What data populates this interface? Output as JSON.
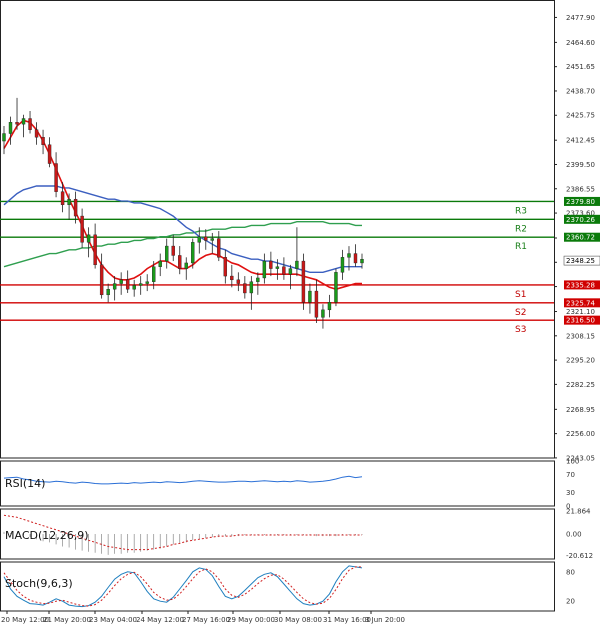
{
  "chart_data": {
    "type": "candlestick",
    "symbol_price_ylim": [
      2243.0,
      2484.0
    ],
    "price_ticks": [
      "2477.90",
      "2464.60",
      "2451.65",
      "2438.70",
      "2425.75",
      "2412.45",
      "2399.50",
      "2386.55",
      "2373.60",
      "2360.30",
      "2347.35",
      "2334.40",
      "2321.10",
      "2308.15",
      "2295.20",
      "2282.25",
      "2268.95",
      "2256.00",
      "2243.05"
    ],
    "x_ticks": [
      "20 May 12:00",
      "21 May 20:00",
      "23 May 04:00",
      "24 May 12:00",
      "27 May 16:00",
      "29 May 00:00",
      "30 May 08:00",
      "31 May 16:00",
      "3 Jun 20:00"
    ],
    "resistance": [
      {
        "label": "R1",
        "value": 2360.72,
        "tag": "2360.72"
      },
      {
        "label": "R2",
        "value": 2370.26,
        "tag": "2370.26"
      },
      {
        "label": "R3",
        "value": 2379.8,
        "tag": "2379.80"
      }
    ],
    "support": [
      {
        "label": "S1",
        "value": 2335.28,
        "tag": "2335.28"
      },
      {
        "label": "S2",
        "value": 2325.74,
        "tag": "2325.74"
      },
      {
        "label": "S3",
        "value": 2316.5,
        "tag": "2316.50"
      }
    ],
    "current_price": {
      "value": 2348.25,
      "tag": "2348.25"
    },
    "candles": [
      [
        2412,
        2420,
        2405,
        2416
      ],
      [
        2416,
        2425,
        2410,
        2422
      ],
      [
        2422,
        2435,
        2418,
        2421
      ],
      [
        2421,
        2426,
        2414,
        2424
      ],
      [
        2424,
        2428,
        2416,
        2418
      ],
      [
        2418,
        2422,
        2410,
        2414
      ],
      [
        2414,
        2418,
        2405,
        2410
      ],
      [
        2410,
        2414,
        2398,
        2400
      ],
      [
        2400,
        2406,
        2382,
        2385
      ],
      [
        2385,
        2390,
        2374,
        2378
      ],
      [
        2378,
        2384,
        2370,
        2381
      ],
      [
        2381,
        2385,
        2368,
        2372
      ],
      [
        2372,
        2376,
        2355,
        2358
      ],
      [
        2358,
        2366,
        2350,
        2362
      ],
      [
        2362,
        2368,
        2344,
        2346
      ],
      [
        2346,
        2352,
        2328,
        2330
      ],
      [
        2330,
        2336,
        2326,
        2333
      ],
      [
        2333,
        2340,
        2327,
        2336
      ],
      [
        2336,
        2342,
        2330,
        2338
      ],
      [
        2338,
        2343,
        2331,
        2333
      ],
      [
        2333,
        2338,
        2329,
        2335
      ],
      [
        2335,
        2340,
        2330,
        2336
      ],
      [
        2336,
        2341,
        2332,
        2337
      ],
      [
        2337,
        2348,
        2333,
        2345
      ],
      [
        2345,
        2352,
        2340,
        2348
      ],
      [
        2348,
        2360,
        2344,
        2356
      ],
      [
        2356,
        2362,
        2348,
        2351
      ],
      [
        2351,
        2356,
        2341,
        2344
      ],
      [
        2344,
        2350,
        2338,
        2347
      ],
      [
        2347,
        2360,
        2344,
        2358
      ],
      [
        2358,
        2366,
        2352,
        2361
      ],
      [
        2361,
        2365,
        2354,
        2359
      ],
      [
        2359,
        2363,
        2352,
        2360
      ],
      [
        2360,
        2364,
        2348,
        2350
      ],
      [
        2350,
        2354,
        2336,
        2340
      ],
      [
        2340,
        2346,
        2334,
        2338
      ],
      [
        2338,
        2342,
        2332,
        2336
      ],
      [
        2336,
        2340,
        2328,
        2331
      ],
      [
        2331,
        2340,
        2322,
        2337
      ],
      [
        2337,
        2342,
        2330,
        2339
      ],
      [
        2339,
        2352,
        2336,
        2348
      ],
      [
        2348,
        2353,
        2340,
        2344
      ],
      [
        2344,
        2349,
        2338,
        2345
      ],
      [
        2345,
        2350,
        2338,
        2341
      ],
      [
        2341,
        2346,
        2333,
        2344
      ],
      [
        2344,
        2366,
        2340,
        2348
      ],
      [
        2348,
        2352,
        2322,
        2326
      ],
      [
        2326,
        2336,
        2320,
        2332
      ],
      [
        2332,
        2338,
        2315,
        2318
      ],
      [
        2318,
        2325,
        2312,
        2322
      ],
      [
        2322,
        2330,
        2318,
        2326
      ],
      [
        2326,
        2344,
        2324,
        2342
      ],
      [
        2342,
        2354,
        2338,
        2350
      ],
      [
        2350,
        2356,
        2343,
        2352
      ],
      [
        2352,
        2357,
        2345,
        2347
      ],
      [
        2347,
        2352,
        2344,
        2349
      ]
    ],
    "ma_red": [
      2408,
      2414,
      2420,
      2423,
      2422,
      2418,
      2412,
      2405,
      2397,
      2389,
      2381,
      2374,
      2367,
      2359,
      2352,
      2346,
      2342,
      2339,
      2338,
      2338,
      2339,
      2341,
      2344,
      2346,
      2348,
      2348,
      2346,
      2344,
      2344,
      2346,
      2349,
      2351,
      2352,
      2351,
      2349,
      2347,
      2346,
      2344,
      2342,
      2341,
      2341,
      2341,
      2341,
      2341,
      2341,
      2341,
      2340,
      2339,
      2338,
      2336,
      2334,
      2333,
      2334,
      2335,
      2336,
      2336
    ],
    "ma_blue": [
      2378,
      2381,
      2384,
      2386,
      2387,
      2388,
      2388,
      2388,
      2388,
      2387,
      2387,
      2386,
      2385,
      2384,
      2383,
      2382,
      2381,
      2381,
      2380,
      2380,
      2379,
      2379,
      2378,
      2377,
      2376,
      2374,
      2372,
      2369,
      2366,
      2364,
      2361,
      2359,
      2357,
      2355,
      2354,
      2352,
      2351,
      2350,
      2349,
      2349,
      2348,
      2348,
      2347,
      2346,
      2345,
      2344,
      2343,
      2342,
      2342,
      2342,
      2343,
      2344,
      2345,
      2345,
      2345,
      2345
    ],
    "ma_green": [
      2345,
      2346,
      2347,
      2348,
      2349,
      2350,
      2351,
      2352,
      2352,
      2353,
      2354,
      2354,
      2355,
      2355,
      2356,
      2356,
      2357,
      2357,
      2358,
      2358,
      2359,
      2359,
      2360,
      2360,
      2361,
      2361,
      2362,
      2362,
      2363,
      2363,
      2364,
      2364,
      2365,
      2365,
      2365,
      2366,
      2366,
      2366,
      2367,
      2367,
      2367,
      2368,
      2368,
      2368,
      2368,
      2369,
      2369,
      2369,
      2369,
      2369,
      2368,
      2368,
      2368,
      2368,
      2367,
      2367
    ],
    "rsi": {
      "label": "RSI(14)",
      "ticks": [
        "100",
        "70",
        "30",
        "0"
      ],
      "values": [
        62,
        63,
        64,
        60,
        58,
        55,
        54,
        53,
        55,
        54,
        52,
        51,
        53,
        52,
        50,
        49,
        49,
        50,
        51,
        50,
        52,
        51,
        52,
        53,
        52,
        54,
        53,
        52,
        53,
        55,
        56,
        55,
        54,
        53,
        53,
        54,
        55,
        55,
        54,
        55,
        56,
        55,
        54,
        55,
        54,
        56,
        55,
        53,
        54,
        55,
        57,
        60,
        64,
        66,
        63,
        65
      ]
    },
    "macd": {
      "label": "MACD(12,26,9)",
      "ticks": [
        "21.864",
        "0.00",
        "-20.612"
      ],
      "hist": [
        2,
        1,
        0,
        -1,
        -3,
        -5,
        -7,
        -8,
        -10,
        -12,
        -13,
        -15,
        -16,
        -17,
        -18,
        -19,
        -20,
        -19,
        -19,
        -18,
        -18,
        -17,
        -16,
        -15,
        -14,
        -12,
        -10,
        -9,
        -8,
        -6,
        -5,
        -4,
        -3,
        -3,
        -2,
        -2,
        -2,
        -1,
        -1,
        -1,
        -1,
        -1,
        -1,
        -1,
        -1,
        -1,
        -1,
        -1,
        -2,
        -2,
        -2,
        -2,
        -1,
        -1,
        -1,
        -1
      ],
      "signal": [
        18,
        17,
        16,
        14,
        12,
        10,
        8,
        6,
        4,
        2,
        0,
        -2,
        -4,
        -6,
        -8,
        -10,
        -12,
        -13,
        -14,
        -15,
        -15,
        -15,
        -15,
        -14,
        -13,
        -12,
        -10,
        -9,
        -7,
        -6,
        -5,
        -4,
        -3,
        -2,
        -2,
        -2,
        -1,
        -1,
        -1,
        -1,
        -1,
        -1,
        -1,
        -1,
        -1,
        -1,
        -1,
        -1,
        -1,
        -1,
        -1,
        -1,
        -1,
        -1,
        -1,
        -1
      ]
    },
    "stoch": {
      "label": "Stoch(9,6,3)",
      "ticks": [
        "80",
        "20"
      ],
      "k": [
        70,
        45,
        30,
        22,
        15,
        14,
        12,
        18,
        25,
        20,
        12,
        10,
        9,
        11,
        18,
        30,
        48,
        65,
        75,
        80,
        78,
        60,
        40,
        25,
        20,
        18,
        28,
        45,
        62,
        80,
        88,
        85,
        72,
        50,
        30,
        25,
        30,
        42,
        55,
        68,
        75,
        78,
        70,
        55,
        40,
        25,
        15,
        12,
        14,
        20,
        35,
        60,
        80,
        92,
        90,
        88
      ],
      "d": [
        78,
        60,
        42,
        30,
        22,
        18,
        15,
        16,
        20,
        22,
        18,
        14,
        11,
        10,
        13,
        22,
        36,
        52,
        66,
        75,
        79,
        70,
        55,
        38,
        28,
        22,
        24,
        35,
        50,
        66,
        80,
        86,
        80,
        65,
        45,
        32,
        28,
        34,
        44,
        56,
        66,
        73,
        74,
        65,
        52,
        38,
        25,
        17,
        14,
        16,
        26,
        44,
        66,
        83,
        90,
        90
      ]
    }
  }
}
